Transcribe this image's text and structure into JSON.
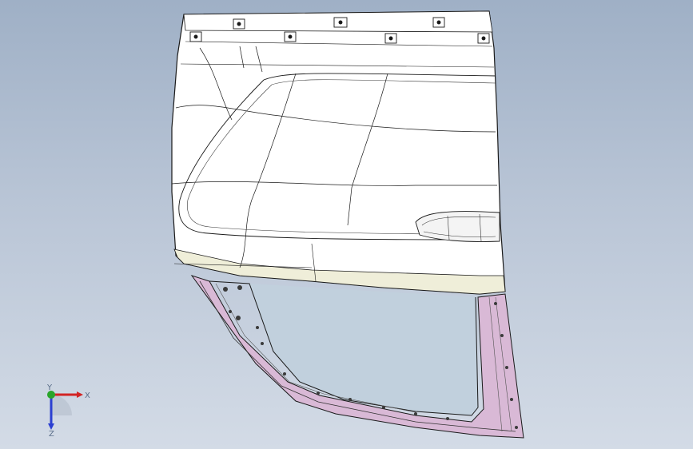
{
  "viewport": {
    "background_top": "#9fb0c6",
    "background_bottom": "#d3dbe6"
  },
  "model": {
    "name": "car-door-assembly",
    "panel_color": "#ffffff",
    "panel_shade_color": "#efeed9",
    "frame_color": "#d9b9d6",
    "edge_color": "#1a1a1a"
  },
  "triad": {
    "x_label": "X",
    "y_label": "Y",
    "z_label": "Z",
    "x_color": "#d22424",
    "y_color": "#2aa52a",
    "z_color": "#2b3fd1"
  }
}
